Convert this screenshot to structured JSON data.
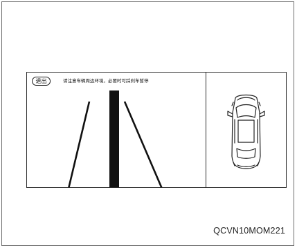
{
  "screen": {
    "exit_label": "退出",
    "warning": "请注意车辆周边环境，必要时可踩刹车暂停"
  },
  "figure": {
    "code": "QCVN10MOM221"
  },
  "icons": {
    "car": "car-top-view-icon"
  },
  "colors": {
    "line": "#111111",
    "border": "#2a2a2a",
    "background": "#ffffff"
  }
}
